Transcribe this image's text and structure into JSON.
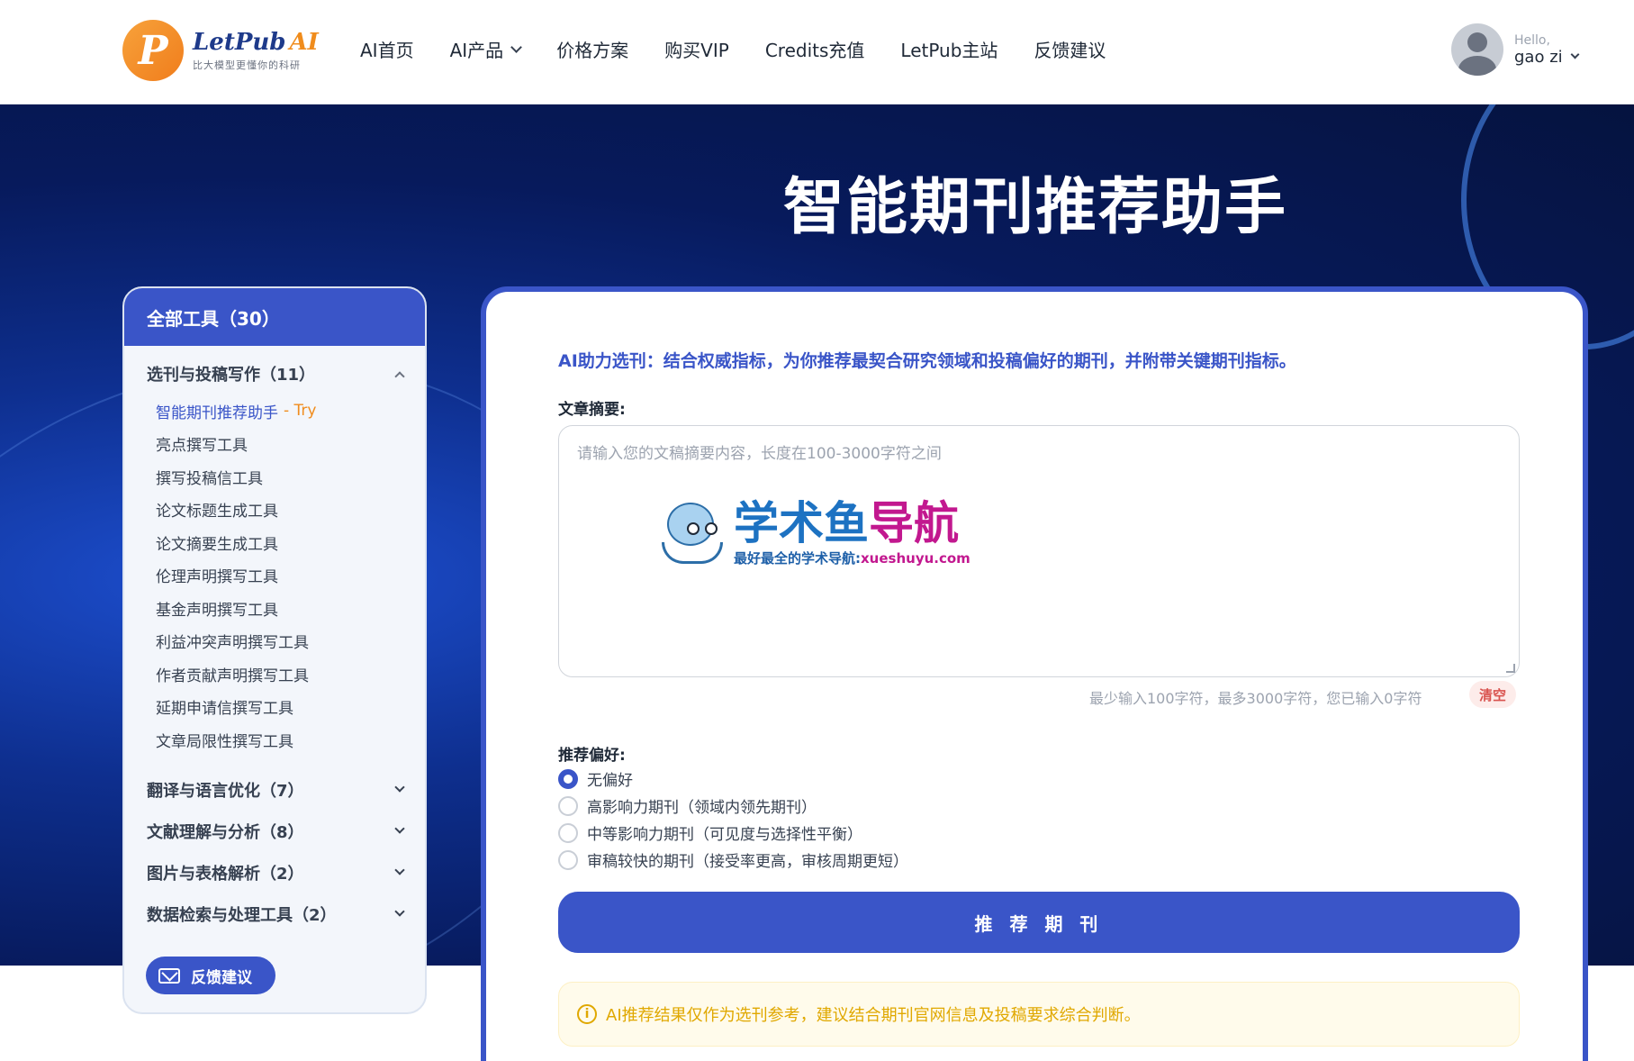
{
  "header": {
    "logo_letter": "P",
    "logo_name": "LetPub",
    "logo_ai": "AI",
    "logo_tagline": "比大模型更懂你的科研",
    "nav": [
      "AI首页",
      "AI产品",
      "价格方案",
      "购买VIP",
      "Credits充值",
      "LetPub主站",
      "反馈建议"
    ],
    "user_hello": "Hello,",
    "user_name": "gao zi"
  },
  "hero": {
    "title": "智能期刊推荐助手"
  },
  "sidebar": {
    "header": "全部工具（30）",
    "expanded_category": "选刊与投稿写作（11）",
    "items": [
      {
        "label": "智能期刊推荐助手",
        "badge": "- Try"
      },
      {
        "label": "亮点撰写工具"
      },
      {
        "label": "撰写投稿信工具"
      },
      {
        "label": "论文标题生成工具"
      },
      {
        "label": "论文摘要生成工具"
      },
      {
        "label": "伦理声明撰写工具"
      },
      {
        "label": "基金声明撰写工具"
      },
      {
        "label": "利益冲突声明撰写工具"
      },
      {
        "label": "作者贡献声明撰写工具"
      },
      {
        "label": "延期申请信撰写工具"
      },
      {
        "label": "文章局限性撰写工具"
      }
    ],
    "collapsed_categories": [
      "翻译与语言优化（7）",
      "文献理解与分析（8）",
      "图片与表格解析（2）",
      "数据检索与处理工具（2）"
    ],
    "feedback_button": "反馈建议"
  },
  "main": {
    "intro": "AI助力选刊：结合权威指标，为你推荐最契合研究领域和投稿偏好的期刊，并附带关键期刊指标。",
    "abstract_label": "文章摘要:",
    "abstract_placeholder": "请输入您的文稿摘要内容，长度在100-3000字符之间",
    "abstract_value": "",
    "counter": "最少输入100字符，最多3000字符，您已输入0字符",
    "clear_button": "清空",
    "preference_label": "推荐偏好:",
    "preferences": [
      {
        "label": "无偏好",
        "checked": true
      },
      {
        "label": "高影响力期刊（领域内领先期刊）",
        "checked": false
      },
      {
        "label": "中等影响力期刊（可见度与选择性平衡）",
        "checked": false
      },
      {
        "label": "审稿较快的期刊（接受率更高，审核周期更短）",
        "checked": false
      }
    ],
    "submit_button": "推 荐 期 刊",
    "notice": "AI推荐结果仅作为选刊参考，建议结合期刊官网信息及投稿要求综合判断。"
  },
  "watermark": {
    "title_blue": "学术鱼",
    "title_pink": "导航",
    "subtitle": "最好最全的学术导航:",
    "url": "xueshuyu.com"
  },
  "colors": {
    "primary": "#3a55c8",
    "accent": "#f08c1c",
    "warning": "#e0a800",
    "danger": "#d9534f"
  }
}
